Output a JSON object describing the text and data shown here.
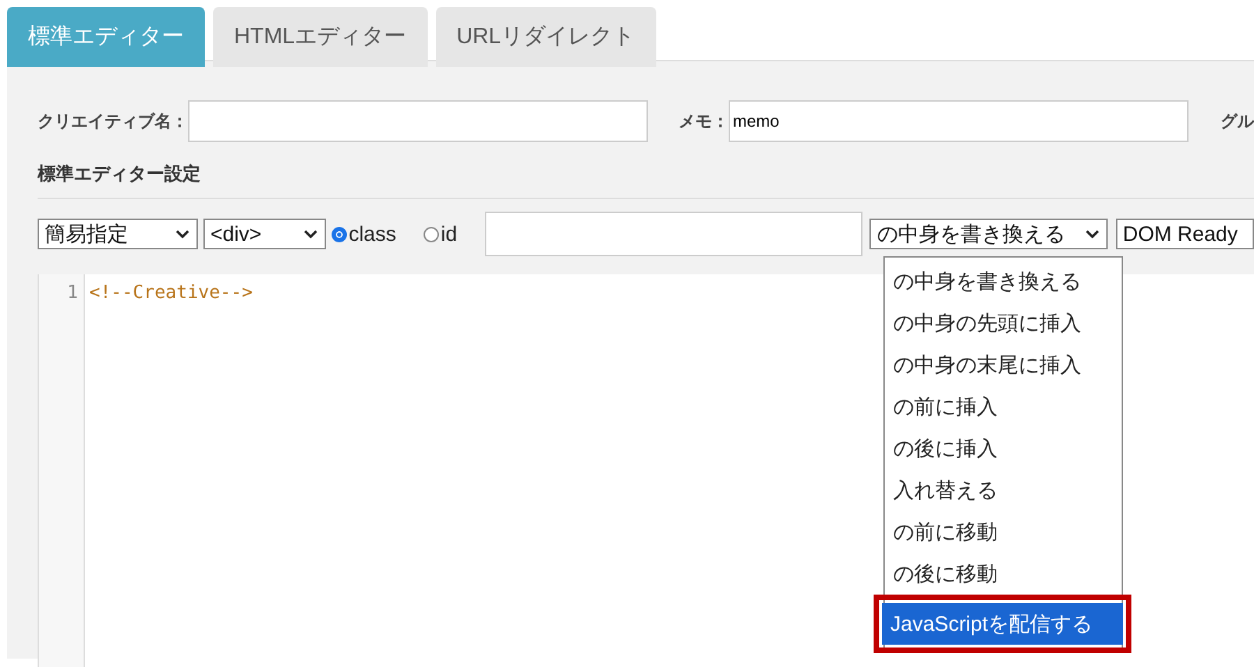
{
  "tabs": [
    {
      "label": "標準エディター",
      "selected": true
    },
    {
      "label": "HTMLエディター",
      "selected": false
    },
    {
      "label": "URLリダイレクト",
      "selected": false
    }
  ],
  "form": {
    "creative_name": {
      "label": "クリエイティブ名："
    },
    "memo": {
      "label": "メモ：",
      "value": "memo"
    },
    "group_label": "グル"
  },
  "section_title": "標準エディター設定",
  "controls": {
    "mode_select": "簡易指定",
    "tag_select": "<div>",
    "radios": [
      {
        "label": "class",
        "selected": true
      },
      {
        "label": "id",
        "selected": false
      }
    ],
    "action_select": "の中身を書き換える",
    "timing_select": "DOM Ready"
  },
  "dropdown": {
    "options": [
      {
        "label": "の中身を書き換える",
        "selected": false,
        "emphasized": false
      },
      {
        "label": "の中身の先頭に挿入",
        "selected": false,
        "emphasized": false
      },
      {
        "label": "の中身の末尾に挿入",
        "selected": false,
        "emphasized": false
      },
      {
        "label": "の前に挿入",
        "selected": false,
        "emphasized": false
      },
      {
        "label": "の後に挿入",
        "selected": false,
        "emphasized": false
      },
      {
        "label": "入れ替える",
        "selected": false,
        "emphasized": false
      },
      {
        "label": "の前に移動",
        "selected": false,
        "emphasized": false
      },
      {
        "label": "の後に移動",
        "selected": false,
        "emphasized": false
      },
      {
        "label": "JavaScriptを配信する",
        "selected": true,
        "emphasized": true
      }
    ]
  },
  "editor": {
    "lines": [
      {
        "number": "1",
        "code": "<!--Creative-->"
      }
    ]
  }
}
